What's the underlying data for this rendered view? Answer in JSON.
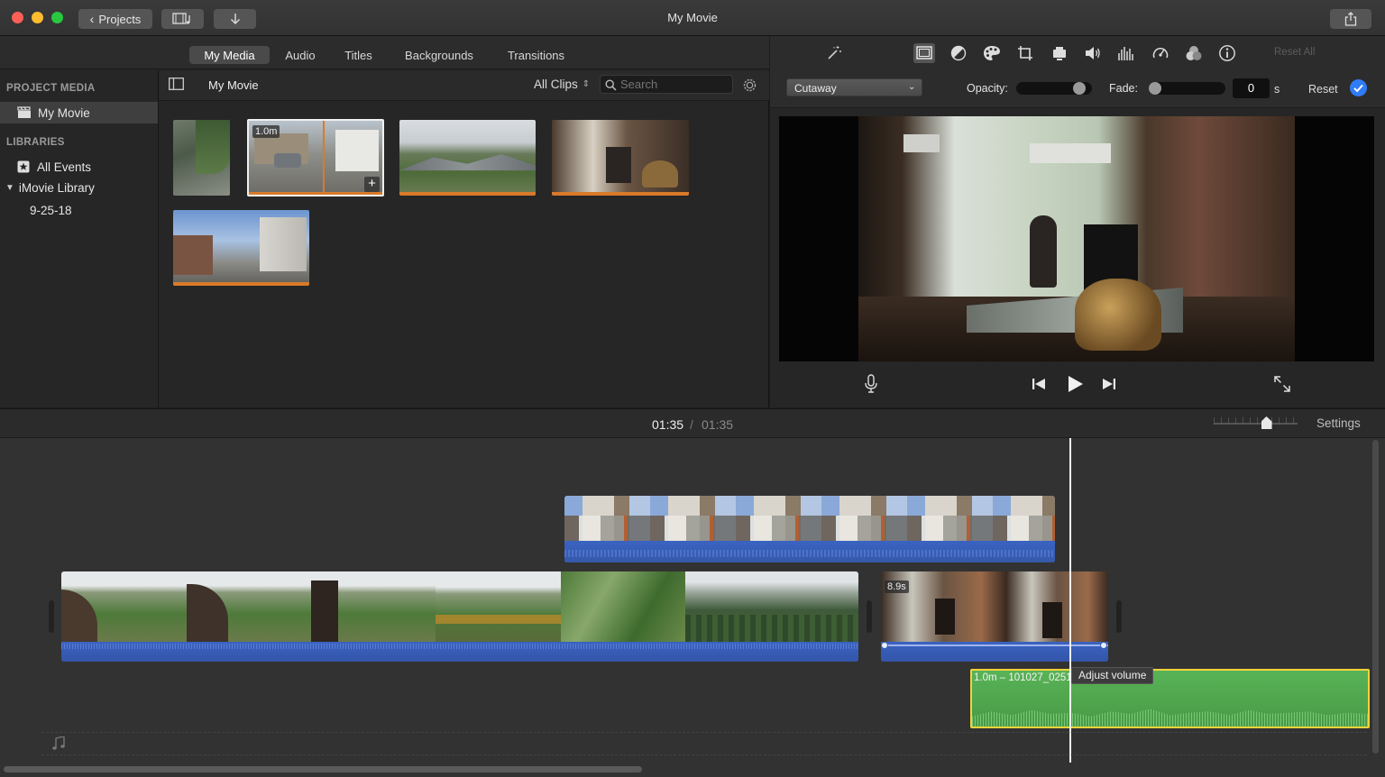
{
  "window": {
    "title": "My Movie"
  },
  "toolbar": {
    "projects_label": "Projects"
  },
  "tabs": [
    {
      "label": "My Media",
      "active": true
    },
    {
      "label": "Audio"
    },
    {
      "label": "Titles"
    },
    {
      "label": "Backgrounds"
    },
    {
      "label": "Transitions"
    }
  ],
  "sidebar": {
    "project_media_heading": "PROJECT MEDIA",
    "project_item": "My Movie",
    "libraries_heading": "LIBRARIES",
    "all_events": "All Events",
    "library": "iMovie Library",
    "event": "9-25-18"
  },
  "browser": {
    "title": "My Movie",
    "filter": "All Clips",
    "search_placeholder": "Search",
    "selected_clip_duration": "1.0m"
  },
  "viewer": {
    "overlay_mode": "Cutaway",
    "opacity_label": "Opacity:",
    "opacity_value": 0.9,
    "fade_label": "Fade:",
    "fade_value": "0",
    "fade_unit": "s",
    "reset_label": "Reset",
    "reset_all_label": "Reset All"
  },
  "timeline": {
    "current_time": "01:35",
    "separator": "/",
    "total_time": "01:35",
    "settings_label": "Settings",
    "zoom_level": 0.63,
    "clip_duration_badge": "8.9s",
    "audio_clip_label": "1.0m – 101027_0251",
    "tooltip": "Adjust volume"
  },
  "colors": {
    "accent": "#2f7cf6",
    "audio_blue": "#3a5fb5",
    "music_green": "#4fa34a",
    "selection_yellow": "#f1d33a",
    "clip_orange": "#d97a2a"
  }
}
